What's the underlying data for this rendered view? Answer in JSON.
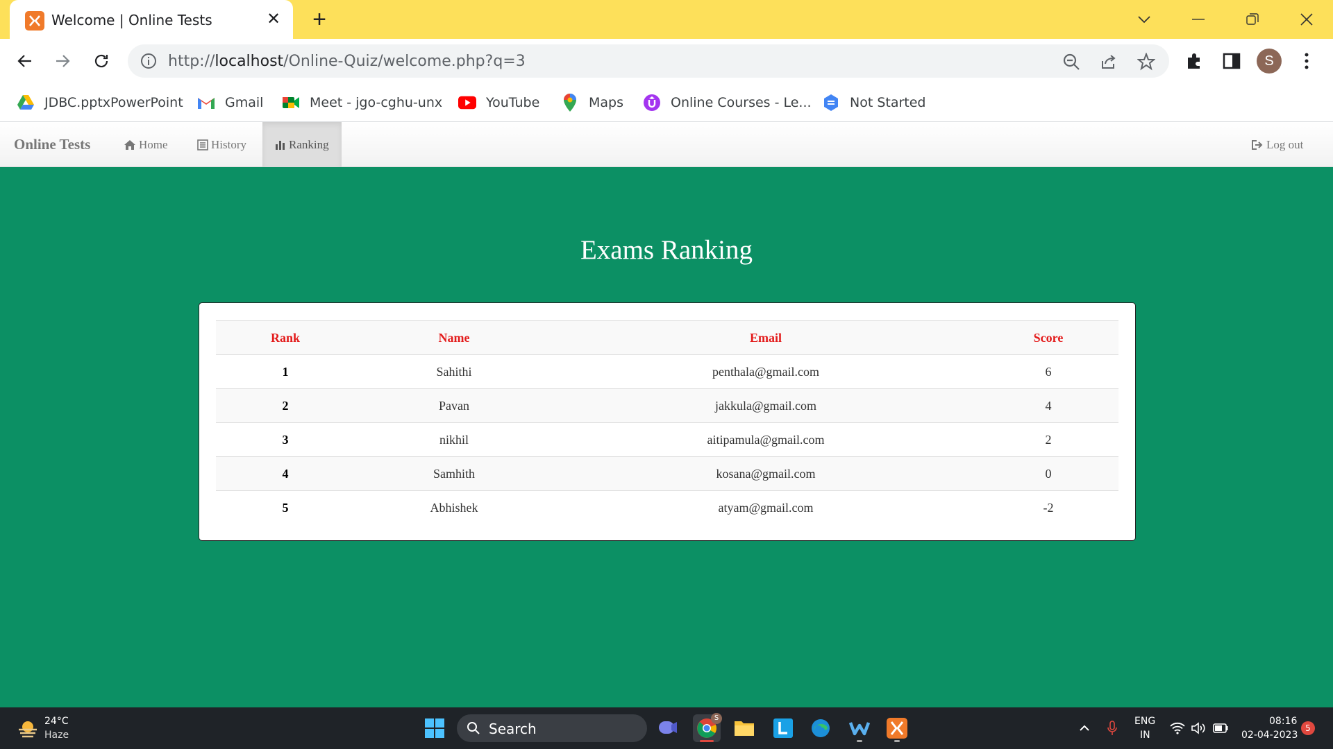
{
  "browser": {
    "tab_title": "Welcome | Online Tests",
    "url_scheme": "http://",
    "url_host": "localhost",
    "url_path": "/Online-Quiz/welcome.php?q=3",
    "profile_initial": "S",
    "bookmarks": [
      {
        "label": "JDBC.pptxPowerPoint",
        "icon": "google-drive-icon"
      },
      {
        "label": "Gmail",
        "icon": "gmail-icon"
      },
      {
        "label": "Meet - jgo-cghu-unx",
        "icon": "google-meet-icon"
      },
      {
        "label": "YouTube",
        "icon": "youtube-icon"
      },
      {
        "label": "Maps",
        "icon": "google-maps-icon"
      },
      {
        "label": "Online Courses - Le...",
        "icon": "udemy-icon"
      },
      {
        "label": "Not Started",
        "icon": "document-icon"
      }
    ]
  },
  "navbar": {
    "brand": "Online Tests",
    "items": [
      {
        "label": "Home",
        "icon": "home-icon",
        "active": false
      },
      {
        "label": "History",
        "icon": "list-icon",
        "active": false
      },
      {
        "label": "Ranking",
        "icon": "bar-chart-icon",
        "active": true
      }
    ],
    "logout": "Log out"
  },
  "page": {
    "title": "Exams Ranking",
    "table": {
      "headers": [
        "Rank",
        "Name",
        "Email",
        "Score"
      ],
      "rows": [
        [
          "1",
          "Sahithi",
          "penthala@gmail.com",
          "6"
        ],
        [
          "2",
          "Pavan",
          "jakkula@gmail.com",
          "4"
        ],
        [
          "3",
          "nikhil",
          "aitipamula@gmail.com",
          "2"
        ],
        [
          "4",
          "Samhith",
          "kosana@gmail.com",
          "0"
        ],
        [
          "5",
          "Abhishek",
          "atyam@gmail.com",
          "-2"
        ]
      ]
    }
  },
  "taskbar": {
    "weather_temp": "24°C",
    "weather_desc": "Haze",
    "search_label": "Search",
    "lang_line1": "ENG",
    "lang_line2": "IN",
    "time": "08:16",
    "date": "02-04-2023",
    "notification_count": "5",
    "chrome_badge": "S"
  },
  "colors": {
    "tabstrip": "#fde05a",
    "page_bg": "#0c9064",
    "header_text": "#e31b1b"
  }
}
